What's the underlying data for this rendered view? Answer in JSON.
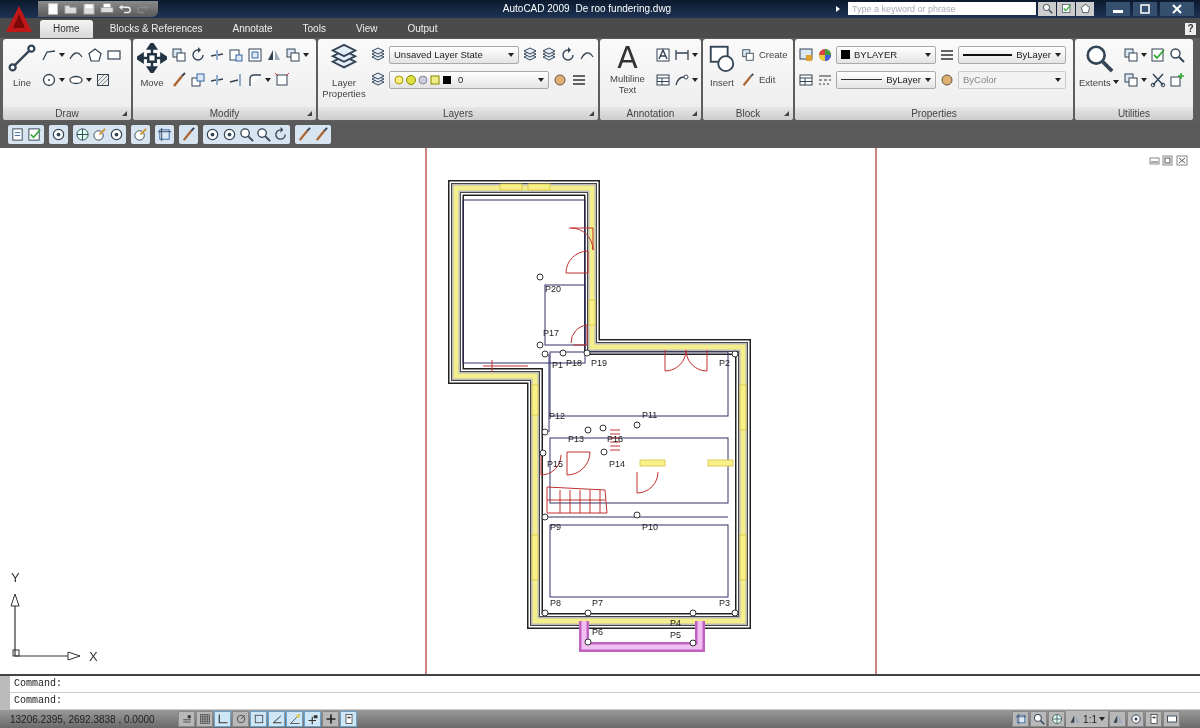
{
  "title_bar": {
    "app_name": "AutoCAD 2009",
    "document": "De roo fundering.dwg",
    "search": {
      "placeholder": "Type a keyword or phrase"
    }
  },
  "tabs": [
    {
      "label": "Home",
      "selected": true
    },
    {
      "label": "Blocks & References",
      "selected": false
    },
    {
      "label": "Annotate",
      "selected": false
    },
    {
      "label": "Tools",
      "selected": false
    },
    {
      "label": "View",
      "selected": false
    },
    {
      "label": "Output",
      "selected": false
    }
  ],
  "help": "?",
  "ribbon": [
    {
      "title": "Draw",
      "launcher": true,
      "large_tools": [
        {
          "label": "Line",
          "dropdown": false
        }
      ]
    },
    {
      "title": "Modify",
      "launcher": true,
      "large_tools": [
        {
          "label": "Move",
          "dropdown": false
        }
      ]
    },
    {
      "title": "Layers",
      "launcher": true,
      "large_tools": [
        {
          "label": "Layer Properties",
          "dropdown": false
        }
      ],
      "dropdowns": [
        {
          "value": "Unsaved Layer State",
          "kind": "plain",
          "disabled": false
        },
        {
          "value": "0",
          "kind": "layer",
          "disabled": false
        }
      ]
    },
    {
      "title": "Annotation",
      "launcher": true,
      "large_tools": [
        {
          "label": "Multiline Text",
          "glyph": "A",
          "dropdown": false
        }
      ]
    },
    {
      "title": "Block",
      "launcher": true,
      "large_tools": [
        {
          "label": "Insert",
          "dropdown": false
        }
      ],
      "small_tools": [
        {
          "label": "Create"
        },
        {
          "label": "Edit"
        }
      ]
    },
    {
      "title": "Properties",
      "launcher": false,
      "dropdowns": [
        {
          "value": "BYLAYER",
          "kind": "color",
          "disabled": false
        },
        {
          "value": "ByLayer",
          "kind": "lineweight",
          "disabled": false
        },
        {
          "value": "ByLayer",
          "kind": "linetype",
          "disabled": false
        },
        {
          "value": "ByColor",
          "kind": "plain",
          "disabled": true
        }
      ]
    },
    {
      "title": "Utilities",
      "launcher": false,
      "large_tools": [
        {
          "label": "Extents",
          "dropdown": true
        }
      ]
    }
  ],
  "plan": {
    "points": [
      "P20",
      "P17",
      "P1",
      "P18",
      "P19",
      "P2",
      "P12",
      "P11",
      "P13",
      "P16",
      "P15",
      "P14",
      "P9",
      "P10",
      "P8",
      "P7",
      "P3",
      "P6",
      "P4",
      "P5"
    ]
  },
  "ucs": {
    "x_label": "X",
    "y_label": "Y"
  },
  "command_lines": [
    "Command:",
    "Command:"
  ],
  "status_bar": {
    "coordinates": "13206.2395, 2692.3838 , 0.0000",
    "toggles": [
      {
        "on": false
      },
      {
        "on": false
      },
      {
        "on": true
      },
      {
        "on": false
      },
      {
        "on": true
      },
      {
        "on": true
      },
      {
        "on": true
      },
      {
        "on": true
      },
      {
        "on": false
      },
      {
        "on": true
      }
    ],
    "annotation_scale": "1:1"
  }
}
